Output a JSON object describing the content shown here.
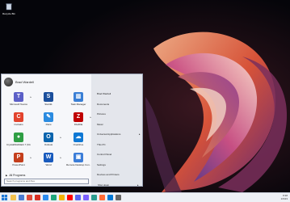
{
  "desktop": {
    "recycle_bin_label": "Recycle Bin"
  },
  "start_menu": {
    "user_name": "Brad Wardell",
    "tiles": [
      {
        "name": "microsoft-teams-tile",
        "label": "Microsoft Teams",
        "color": "#5b5fc7",
        "glyph": "T",
        "has_arrow": true
      },
      {
        "name": "start11-tile",
        "label": "Start11",
        "color": "#1b4f9c",
        "glyph": "S",
        "has_arrow": false
      },
      {
        "name": "task-manager-tile",
        "label": "Task Manager",
        "color": "#3a7fd5",
        "glyph": "▥",
        "has_arrow": false
      },
      {
        "name": "curtains-tile",
        "label": "Curtains",
        "color": "#e2432d",
        "glyph": "C",
        "has_arrow": false
      },
      {
        "name": "paint-tile",
        "label": "Paint",
        "color": "#2b8be0",
        "glyph": "✎",
        "has_arrow": false
      },
      {
        "name": "filezilla-tile",
        "label": "FileZilla",
        "color": "#bf0000",
        "glyph": "Z",
        "has_arrow": true
      },
      {
        "name": "crystaldiskmark-tile",
        "label": "CrystalDiskMark 7 (64...",
        "color": "#2f9e44",
        "glyph": "●",
        "has_arrow": false
      },
      {
        "name": "outlook-tile",
        "label": "Outlook",
        "color": "#0a64ad",
        "glyph": "O",
        "has_arrow": true
      },
      {
        "name": "onedrive-tile",
        "label": "OneDrive",
        "color": "#0f78d4",
        "glyph": "☁",
        "has_arrow": false
      },
      {
        "name": "powerpoint-tile",
        "label": "PowerPoint",
        "color": "#c43e1c",
        "glyph": "P",
        "has_arrow": true
      },
      {
        "name": "word-tile",
        "label": "Word",
        "color": "#185abd",
        "glyph": "W",
        "has_arrow": true
      },
      {
        "name": "remote-desktop-tile",
        "label": "Remote Desktop Con...",
        "color": "#3b7dd8",
        "glyph": "▣",
        "has_arrow": false
      }
    ],
    "all_programs_label": "All Programs",
    "search_placeholder": "Search programs and files",
    "right_links": [
      {
        "name": "link-user",
        "label": "Brad Wardell",
        "chevron": false
      },
      {
        "name": "link-documents",
        "label": "Documents",
        "chevron": false
      },
      {
        "name": "link-pictures",
        "label": "Pictures",
        "chevron": false
      },
      {
        "name": "link-music",
        "label": "Music",
        "chevron": false
      },
      {
        "name": "link-universal-applications",
        "label": "Universal Applications",
        "chevron": true
      },
      {
        "name": "link-this-pc",
        "label": "This PC",
        "chevron": false
      },
      {
        "name": "link-control-panel",
        "label": "Control Panel",
        "chevron": false
      },
      {
        "name": "link-settings",
        "label": "Settings",
        "chevron": false
      },
      {
        "name": "link-devices-printers",
        "label": "Devices and Printers",
        "chevron": false
      }
    ],
    "shutdown_label": "Shut down"
  },
  "taskbar": {
    "apps": [
      {
        "name": "taskbar-explorer",
        "color": "#f2c14e"
      },
      {
        "name": "taskbar-app-2",
        "color": "#4a7bd1"
      },
      {
        "name": "taskbar-app-3",
        "color": "#e04b3a"
      },
      {
        "name": "taskbar-gmail",
        "color": "#d93025"
      },
      {
        "name": "taskbar-app-5",
        "color": "#2d8cf0"
      },
      {
        "name": "taskbar-edge",
        "color": "#1ea67b"
      },
      {
        "name": "taskbar-chrome",
        "color": "#f4b400"
      },
      {
        "name": "taskbar-youtube",
        "color": "#ff0000"
      },
      {
        "name": "taskbar-app-9",
        "color": "#5865f2"
      },
      {
        "name": "taskbar-app-10",
        "color": "#7b61ff"
      },
      {
        "name": "taskbar-app-11",
        "color": "#2a9d8f"
      },
      {
        "name": "taskbar-app-12",
        "color": "#ff6b35"
      },
      {
        "name": "taskbar-app-13",
        "color": "#0078d4"
      },
      {
        "name": "taskbar-app-14",
        "color": "#666666"
      }
    ],
    "time": "8:38",
    "date": "1/6/23"
  }
}
